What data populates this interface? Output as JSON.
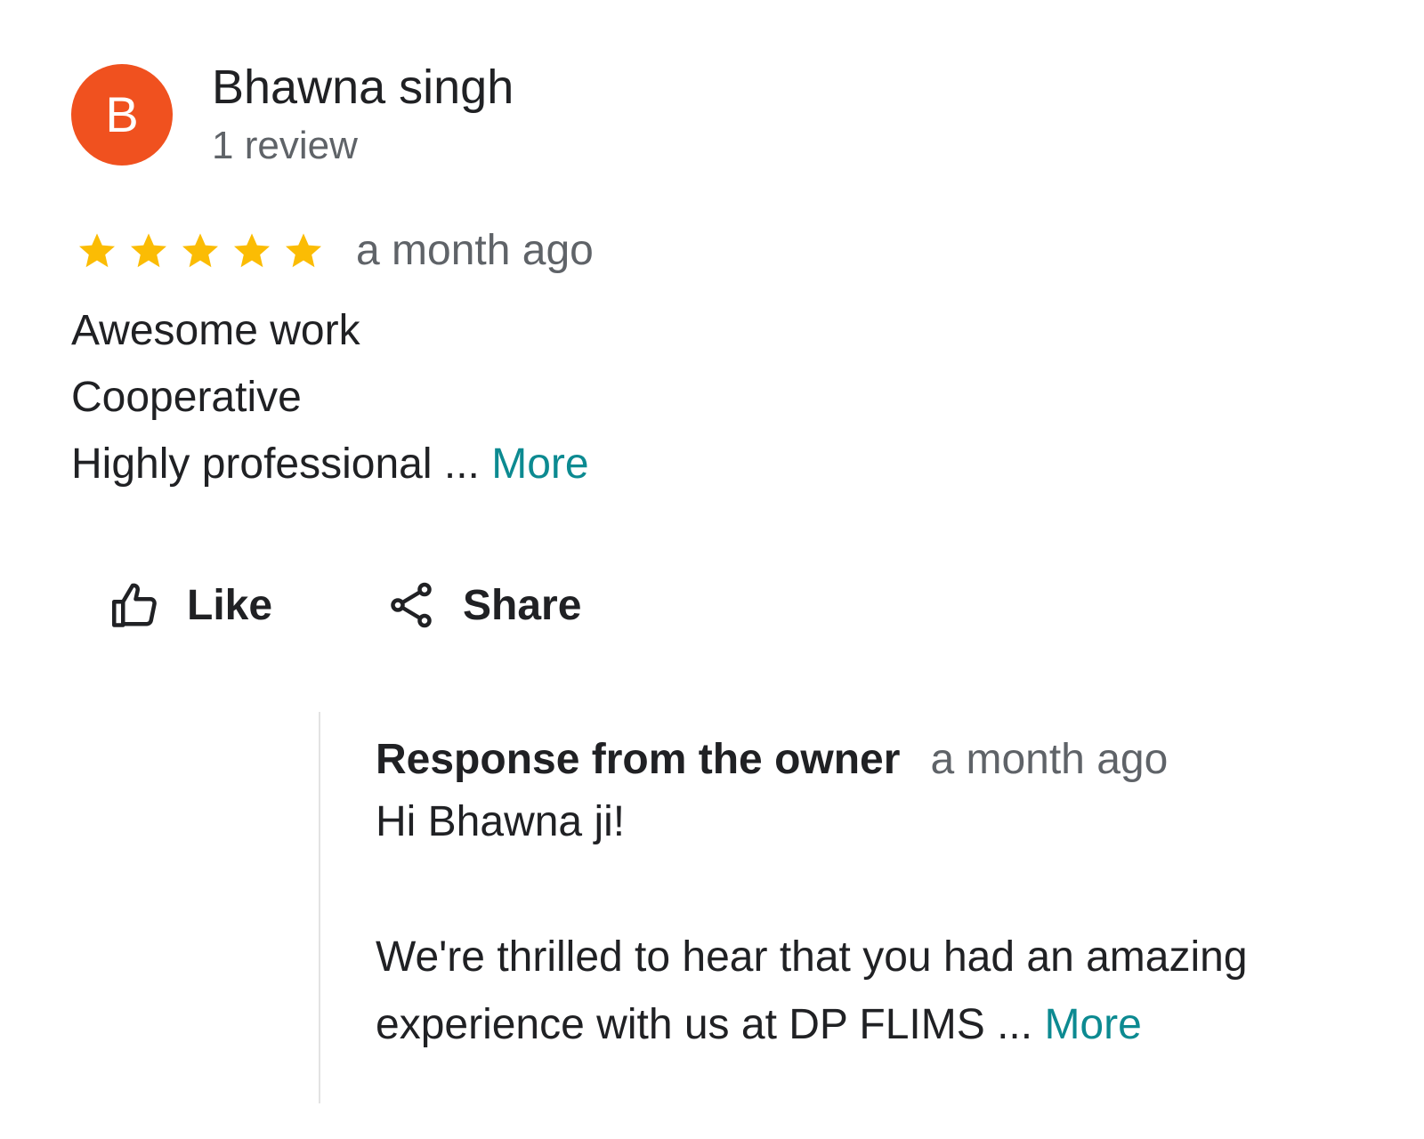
{
  "reviewer": {
    "avatar_letter": "B",
    "avatar_color": "#f0511f",
    "name": "Bhawna singh",
    "review_count": "1 review"
  },
  "review": {
    "rating": 5,
    "max_rating": 5,
    "star_color": "#fbbc04",
    "time": "a month ago",
    "lines": [
      "Awesome work",
      "Cooperative",
      "Highly professional"
    ],
    "ellipsis": " ... ",
    "more_label": "More"
  },
  "actions": {
    "like_label": "Like",
    "like_icon": "thumbs-up-icon",
    "share_label": "Share",
    "share_icon": "share-icon"
  },
  "owner_response": {
    "title": "Response from the owner",
    "time": "a month ago",
    "greeting": "Hi Bhawna ji!",
    "line1": "We're thrilled to hear that you had an amazing",
    "line2": "experience with us at DP FLIMS",
    "ellipsis": " ... ",
    "more_label": "More"
  },
  "colors": {
    "link": "#0c8a91",
    "secondary_text": "#5f6368",
    "primary_text": "#202124"
  }
}
